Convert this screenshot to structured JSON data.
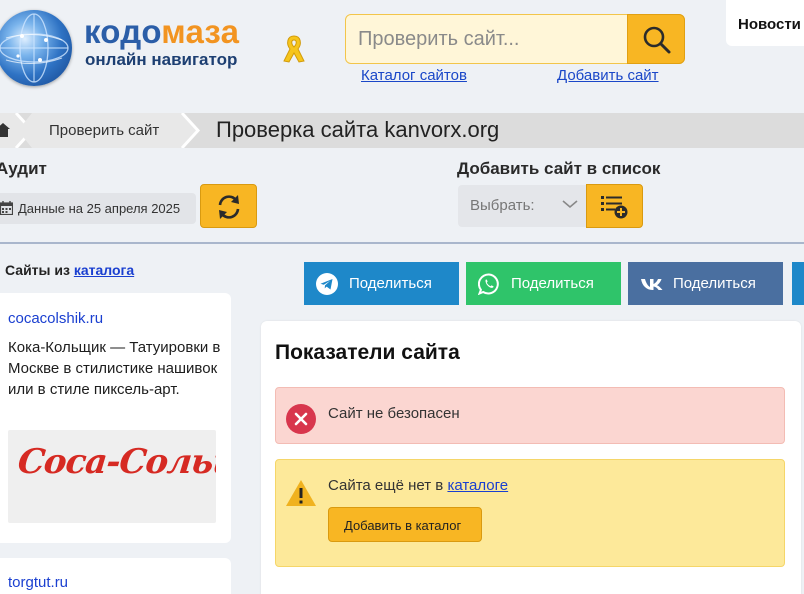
{
  "brand": {
    "name_part1": "кодо",
    "name_part2": "маза",
    "tagline": "онлайн навигатор"
  },
  "search": {
    "placeholder": "Проверить сайт..."
  },
  "header_links": {
    "catalog": "Каталог сайтов",
    "add_site": "Добавить сайт"
  },
  "news_label": "Новости",
  "breadcrumb": {
    "item": "Проверить сайт",
    "title": "Проверка сайта kanvorx.org"
  },
  "audit": {
    "heading": "Аудит",
    "date": "Данные на 25 апреля 2025"
  },
  "add_to_list": {
    "heading": "Добавить сайт в список",
    "select_value": "Выбрать:"
  },
  "sidebar": {
    "heading_prefix": "Сайты из",
    "heading_link": "каталога",
    "cards": [
      {
        "domain": "cocacolshik.ru",
        "description": "Кока-Кольщик — Татуировки в Москве в стилистике нашивок или в стиле пиксель-арт.",
        "image_text": "Coca-Cольщик"
      },
      {
        "domain": "torgtut.ru"
      }
    ]
  },
  "share": {
    "telegram": "Поделиться",
    "whatsapp": "Поделиться",
    "vk": "Поделиться"
  },
  "panel": {
    "title": "Показатели сайта",
    "danger_text": "Сайт не безопасен",
    "warn_text_prefix": "Сайта ещё нет в",
    "warn_link": "каталоге",
    "add_button": "Добавить в каталог"
  },
  "colors": {
    "accent": "#f8b623",
    "link": "#1a3fd0",
    "telegram": "#1e88c9",
    "whatsapp": "#2fc46a",
    "vk": "#4a6fa0",
    "danger_bg": "#fbd6d1",
    "warn_bg": "#fde99a"
  },
  "icons": {
    "logo": "globe-logo-icon",
    "ribbon": "yellow-ribbon-icon",
    "search": "search-icon",
    "home": "home-icon",
    "calendar": "calendar-icon",
    "refresh": "refresh-icon",
    "chevron": "chevron-down-icon",
    "list_add": "list-add-icon",
    "telegram": "telegram-icon",
    "whatsapp": "whatsapp-icon",
    "vk": "vk-icon",
    "danger": "error-x-icon",
    "warning": "warning-icon"
  }
}
